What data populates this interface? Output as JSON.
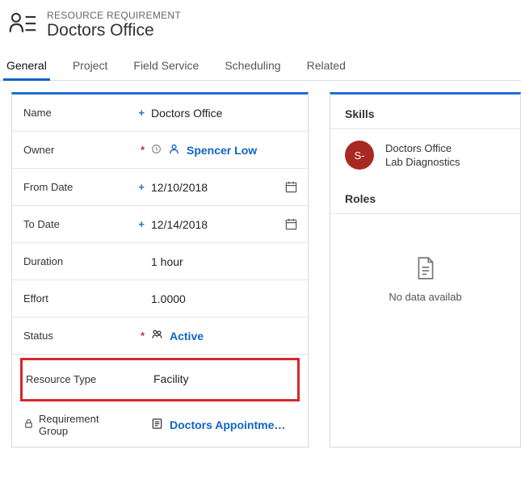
{
  "header": {
    "breadcrumb": "RESOURCE REQUIREMENT",
    "title": "Doctors Office"
  },
  "tabs": [
    {
      "label": "General",
      "active": true
    },
    {
      "label": "Project",
      "active": false
    },
    {
      "label": "Field Service",
      "active": false
    },
    {
      "label": "Scheduling",
      "active": false
    },
    {
      "label": "Related",
      "active": false
    }
  ],
  "fields": {
    "name": {
      "label": "Name",
      "mark": "blue",
      "value": "Doctors Office"
    },
    "owner": {
      "label": "Owner",
      "mark": "red",
      "value": "Spencer Low",
      "type": "person"
    },
    "from_date": {
      "label": "From Date",
      "mark": "blue",
      "value": "12/10/2018",
      "type": "date"
    },
    "to_date": {
      "label": "To Date",
      "mark": "blue",
      "value": "12/14/2018",
      "type": "date"
    },
    "duration": {
      "label": "Duration",
      "mark": "",
      "value": "1 hour"
    },
    "effort": {
      "label": "Effort",
      "mark": "",
      "value": "1.0000"
    },
    "status": {
      "label": "Status",
      "mark": "red",
      "value": "Active",
      "type": "status"
    },
    "resource_type": {
      "label": "Resource Type",
      "mark": "",
      "value": "Facility"
    },
    "req_group": {
      "label": "Requirement Group",
      "locked": true,
      "value": "Doctors Appointme…",
      "type": "lookup"
    }
  },
  "right": {
    "skills_title": "Skills",
    "avatar_initials": "S-",
    "skill_lines": [
      "Doctors Office",
      "Lab Diagnostics"
    ],
    "roles_title": "Roles",
    "empty_text": "No data availab"
  }
}
